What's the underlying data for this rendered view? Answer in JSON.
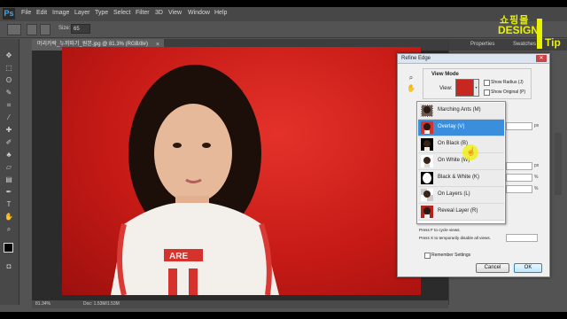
{
  "app": {
    "logo_letters": "Ps",
    "menu": [
      "File",
      "Edit",
      "Image",
      "Layer",
      "Type",
      "Select",
      "Filter",
      "3D",
      "View",
      "Window",
      "Help"
    ]
  },
  "options_bar": {
    "size_label": "Size:",
    "size_value": "65"
  },
  "document": {
    "tab_label": "머리카락_누끼따기_원본.jpg @ 81.3% (RGB/8#)",
    "close_glyph": "×",
    "zoom": "81.34%",
    "doc_info": "Doc: 1.53M/1.53M"
  },
  "panel_right": {
    "tabs": [
      "Properties",
      "Swatches"
    ]
  },
  "watermark": {
    "top": "쇼핑몰",
    "middle": "DESIGN",
    "bottom": "Tip"
  },
  "dialog": {
    "title": "Refine Edge",
    "view_mode_title": "View Mode",
    "view_label": "View:",
    "show_radius": "Show Radius (J)",
    "show_original": "Show Original (P)",
    "views": [
      {
        "label": "Marching Ants (M)",
        "thumb": "marching"
      },
      {
        "label": "Overlay (V)",
        "thumb": "overlay"
      },
      {
        "label": "On Black (B)",
        "thumb": "black"
      },
      {
        "label": "On White (W)",
        "thumb": "white"
      },
      {
        "label": "Black & White (K)",
        "thumb": "bw"
      },
      {
        "label": "On Layers (L)",
        "thumb": "layers"
      },
      {
        "label": "Reveal Layer (R)",
        "thumb": "reveal"
      }
    ],
    "selected_index": 1,
    "hint_1": "Press F to cycle views.",
    "hint_2": "Press X to temporarily disable all views.",
    "remember_label": "Remember Settings",
    "cancel_label": "Cancel",
    "ok_label": "OK",
    "units": [
      "px",
      "px",
      "%",
      "%"
    ]
  },
  "colors": {
    "accent_select": "#3b8edb",
    "background_red": "#c61a16",
    "watermark_yellow": "#e9f300"
  }
}
